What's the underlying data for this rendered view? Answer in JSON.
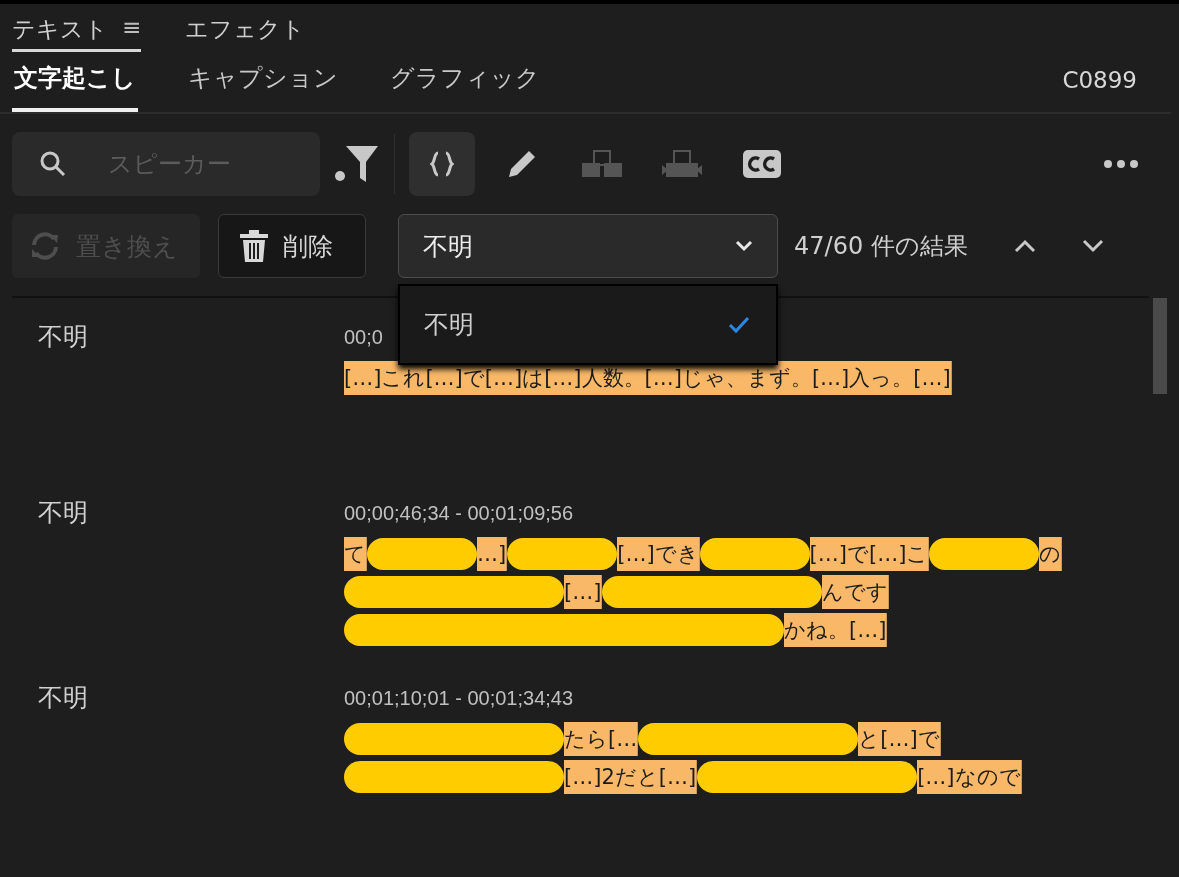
{
  "panel_tabs": [
    {
      "label": "テキスト",
      "selected": true,
      "menu_glyph": "≡"
    },
    {
      "label": "エフェクト",
      "selected": false
    }
  ],
  "sub_tabs": [
    {
      "label": "文字起こし",
      "selected": true
    },
    {
      "label": "キャプション",
      "selected": false
    },
    {
      "label": "グラフィック",
      "selected": false
    }
  ],
  "clip_name": "C0899",
  "search": {
    "placeholder": "スピーカー"
  },
  "tools": [
    {
      "kind": "brackets",
      "selected": true,
      "disabled": false
    },
    {
      "kind": "pencil",
      "selected": false,
      "disabled": false
    },
    {
      "kind": "merge",
      "selected": false,
      "disabled": true
    },
    {
      "kind": "split",
      "selected": false,
      "disabled": true
    },
    {
      "kind": "cc",
      "selected": false,
      "disabled": false
    }
  ],
  "actions": [
    {
      "kind": "replace",
      "label": "置き換え",
      "disabled": true
    },
    {
      "kind": "delete",
      "label": "削除",
      "disabled": false
    }
  ],
  "speaker_select": {
    "value": "不明",
    "expanded": true,
    "options": [
      {
        "label": "不明",
        "selected": true
      }
    ]
  },
  "results": "47/60 件の結果",
  "segments": [
    {
      "speaker": "不明",
      "time": "00;0",
      "lines": [
        [
          {
            "kind": "text",
            "text": "[…]これ[…]で[…]は[…]人数。[…]じゃ、まず。[…]入っ。[…]"
          }
        ]
      ]
    },
    {
      "speaker": "不明",
      "time": "00;00;46;34 - 00;01;09;56",
      "lines": [
        [
          {
            "kind": "text",
            "text": "て"
          },
          {
            "kind": "redacted"
          },
          {
            "kind": "text",
            "text": "…]"
          },
          {
            "kind": "redacted"
          },
          {
            "kind": "text",
            "text": "[…]でき"
          },
          {
            "kind": "redacted"
          },
          {
            "kind": "text",
            "text": "[…]で[…]こ"
          },
          {
            "kind": "redacted"
          },
          {
            "kind": "text",
            "text": "の"
          }
        ],
        [
          {
            "kind": "redacted"
          },
          {
            "kind": "text",
            "text": "[…]"
          },
          {
            "kind": "redacted"
          },
          {
            "kind": "text",
            "text": "んです"
          }
        ],
        [
          {
            "kind": "redacted"
          },
          {
            "kind": "text",
            "text": "かね。[…]"
          }
        ]
      ]
    },
    {
      "speaker": "不明",
      "time": "00;01;10;01 - 00;01;34;43",
      "lines": [
        [
          {
            "kind": "redacted"
          },
          {
            "kind": "text",
            "text": "たら[…"
          },
          {
            "kind": "redacted"
          },
          {
            "kind": "text",
            "text": "と[…]で"
          }
        ],
        [
          {
            "kind": "redacted"
          },
          {
            "kind": "text",
            "text": "[…]2だと[…]"
          },
          {
            "kind": "redacted"
          },
          {
            "kind": "text",
            "text": "[…]なので"
          }
        ]
      ]
    }
  ]
}
